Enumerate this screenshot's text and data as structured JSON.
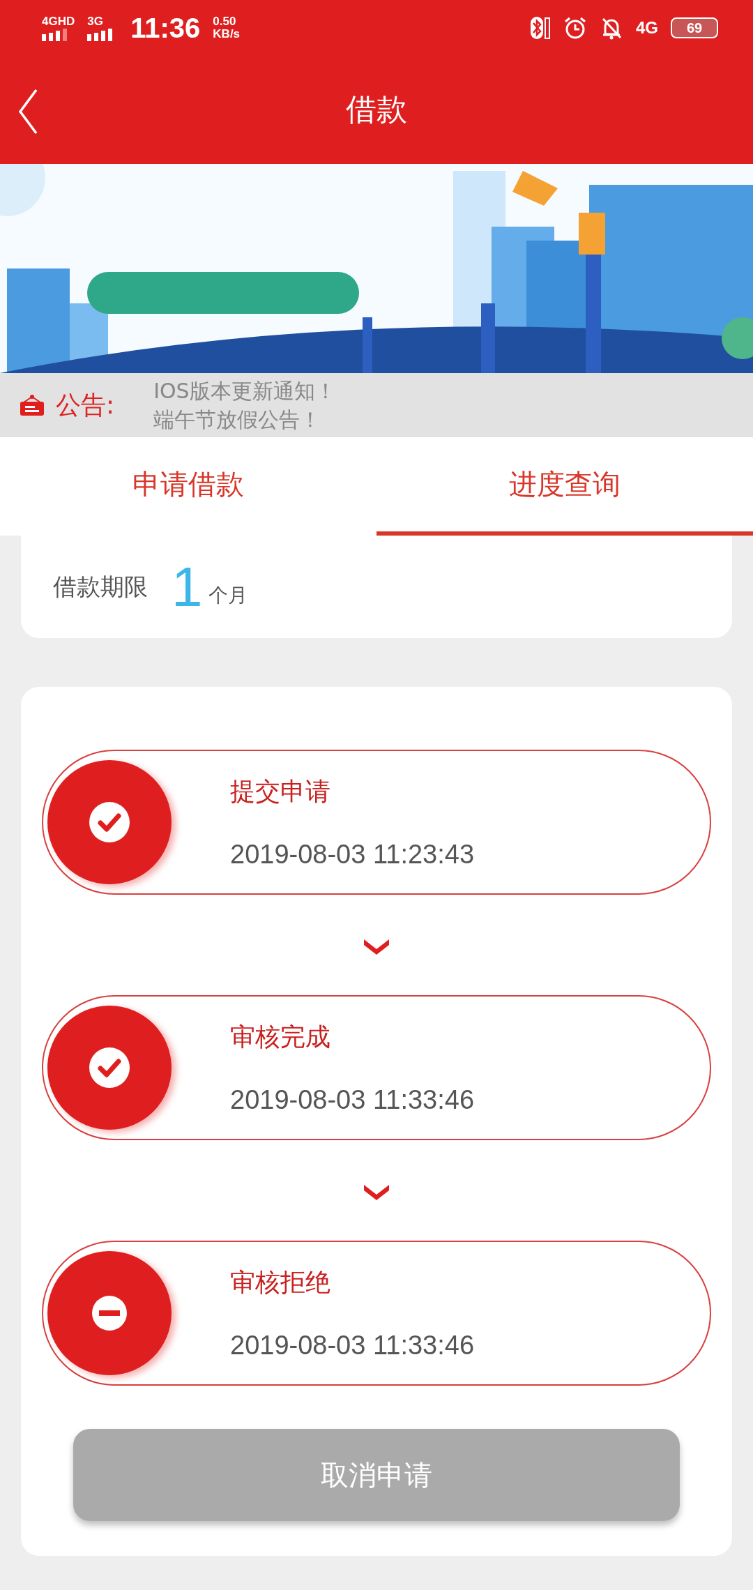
{
  "status_bar": {
    "network_1": "4GHD",
    "network_2": "3G",
    "time": "11:36",
    "speed_value": "0.50",
    "speed_unit": "KB/s",
    "network_3": "4G",
    "battery": "69"
  },
  "header": {
    "title": "借款"
  },
  "notice": {
    "label": "公告:",
    "items": [
      "IOS版本更新通知！",
      "端午节放假公告！"
    ]
  },
  "tabs": [
    {
      "label": "申请借款",
      "selected": false
    },
    {
      "label": "进度查询",
      "selected": true
    }
  ],
  "loan_term": {
    "label": "借款期限",
    "value": "1",
    "unit": "个月"
  },
  "steps": [
    {
      "title": "提交申请",
      "time": "2019-08-03 11:23:43",
      "kind": "done"
    },
    {
      "title": "审核完成",
      "time": "2019-08-03 11:33:46",
      "kind": "done"
    },
    {
      "title": "审核拒绝",
      "time": "2019-08-03 11:33:46",
      "kind": "rejected"
    }
  ],
  "cancel_button": {
    "label": "取消申请",
    "disabled": true
  }
}
